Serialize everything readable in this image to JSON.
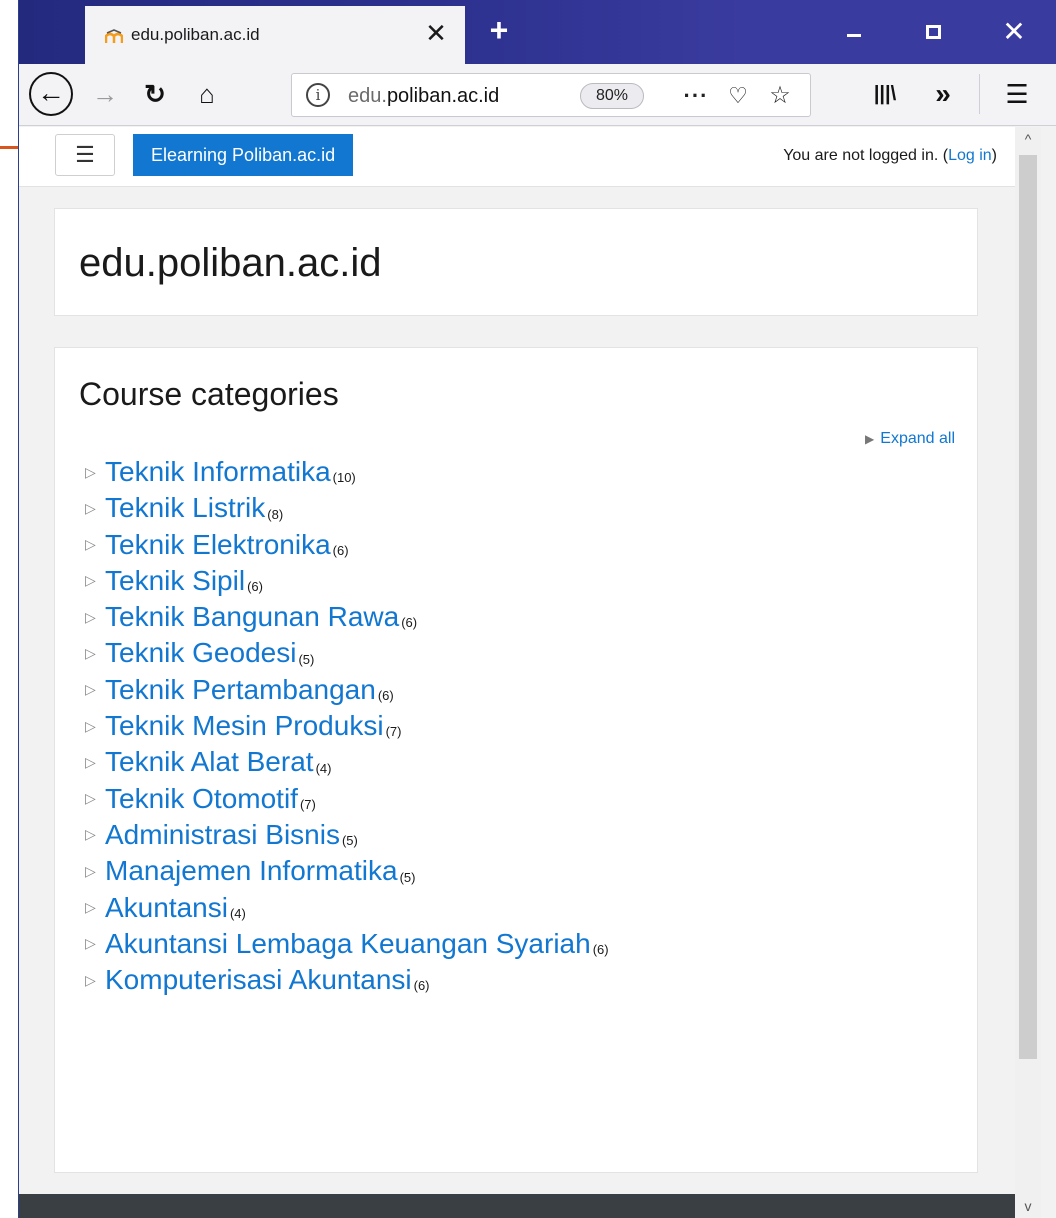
{
  "browser": {
    "tab_title": "edu.poliban.ac.id",
    "url_prefix": "edu.",
    "url_domain": "poliban.ac.id",
    "zoom": "80%"
  },
  "site": {
    "brand": "Elearning Poliban.ac.id",
    "login_text": "You are not logged in. (",
    "login_link": "Log in",
    "login_suffix": ")",
    "page_heading": "edu.poliban.ac.id",
    "categories_heading": "Course categories",
    "expand_all": "Expand all"
  },
  "categories": [
    {
      "name": "Teknik Informatika",
      "count": "(10)"
    },
    {
      "name": "Teknik Listrik",
      "count": "(8)"
    },
    {
      "name": "Teknik Elektronika",
      "count": "(6)"
    },
    {
      "name": "Teknik Sipil",
      "count": "(6)"
    },
    {
      "name": "Teknik Bangunan Rawa",
      "count": "(6)"
    },
    {
      "name": "Teknik Geodesi",
      "count": "(5)"
    },
    {
      "name": "Teknik Pertambangan",
      "count": "(6)"
    },
    {
      "name": "Teknik Mesin Produksi",
      "count": "(7)"
    },
    {
      "name": "Teknik Alat Berat",
      "count": "(4)"
    },
    {
      "name": "Teknik Otomotif",
      "count": "(7)"
    },
    {
      "name": "Administrasi Bisnis",
      "count": "(5)"
    },
    {
      "name": "Manajemen Informatika",
      "count": "(5)"
    },
    {
      "name": "Akuntansi",
      "count": "(4)"
    },
    {
      "name": "Akuntansi Lembaga Keuangan Syariah",
      "count": "(6)"
    },
    {
      "name": "Komputerisasi Akuntansi",
      "count": "(6)"
    }
  ],
  "colors": {
    "link": "#1177d1",
    "titlebar": "#2e3290",
    "footer": "#3a3f43"
  }
}
